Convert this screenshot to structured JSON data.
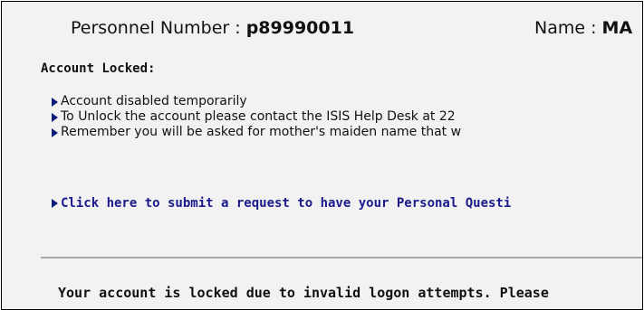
{
  "header": {
    "personnel_label": "Personnel Number : ",
    "personnel_value": "p89990011",
    "name_label": "Name : ",
    "name_value": "MA"
  },
  "account_section": {
    "heading": "Account Locked:",
    "items": [
      "Account disabled temporarily",
      "To Unlock the account please contact the ISIS Help Desk at 22",
      "Remember you will be asked for mother's maiden name that w"
    ],
    "bullet_icon": "triangle-right-icon"
  },
  "request_link": {
    "label": "Click here to submit a request to have your Personal Questi"
  },
  "status_message": "Your account is locked due to invalid logon attempts. Please",
  "colors": {
    "background": "#f2f2f2",
    "link": "#1a1a8c",
    "bullet": "#0a1a7a",
    "divider": "#a8a8a8"
  }
}
